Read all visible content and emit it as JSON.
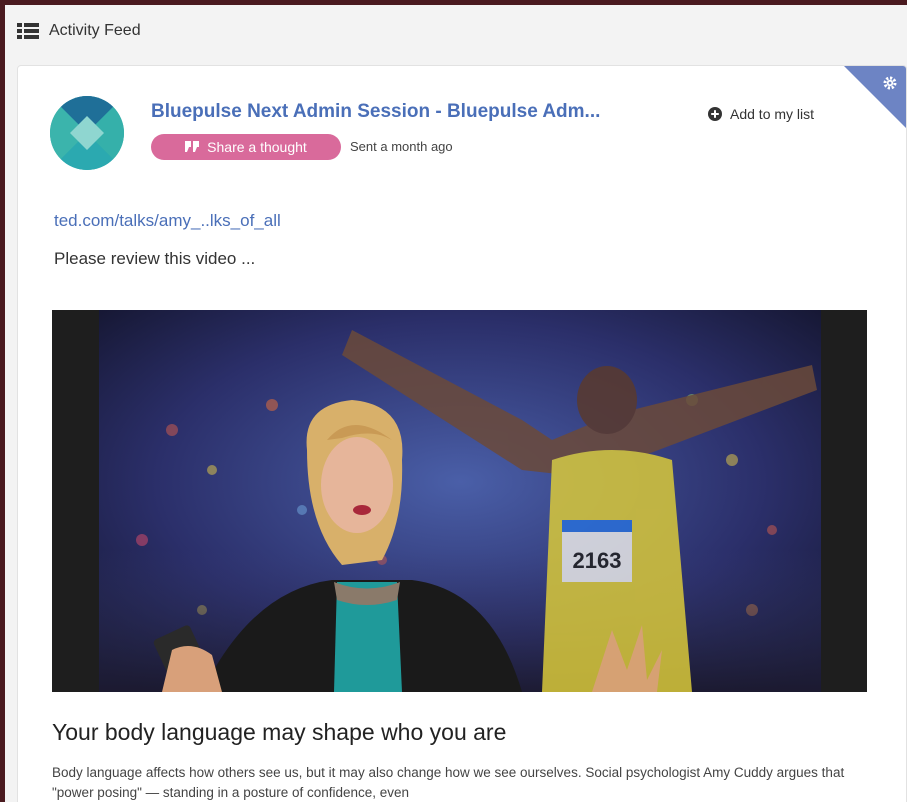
{
  "header": {
    "title": "Activity Feed",
    "icon": "list-icon"
  },
  "post": {
    "title": "Bluepulse Next Admin Session - Bluepulse Adm...",
    "add_to_list_label": "Add to my list",
    "share_label": "Share a thought",
    "sent_time": "Sent a month ago",
    "link_text": "ted.com/talks/amy_..lks_of_all",
    "message": "Please review this video ..."
  },
  "video": {
    "title": "Your body language may shape who you are",
    "description": "Body language affects how others see us, but it may also change how we see ourselves. Social psychologist Amy Cuddy argues that \"power posing\" — standing in a posture of confidence, even",
    "bib_number": "2163"
  },
  "colors": {
    "accent": "#4a6fb8",
    "share_button": "#d96a9b",
    "corner": "#6d84c4"
  }
}
